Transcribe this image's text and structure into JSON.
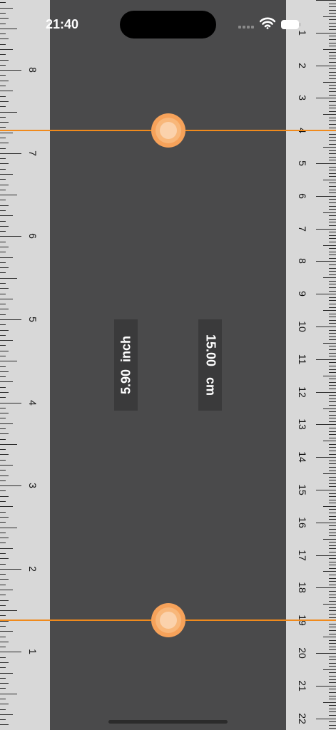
{
  "status_bar": {
    "time": "21:40",
    "icons": [
      "cellular-signal-icon",
      "wifi-icon",
      "battery-icon"
    ]
  },
  "inch_ruler": {
    "labels": [
      "1",
      "2",
      "3",
      "4",
      "5",
      "6",
      "7",
      "8"
    ],
    "unit": "inch"
  },
  "cm_ruler": {
    "labels": [
      "1",
      "2",
      "3",
      "4",
      "5",
      "6",
      "7",
      "8",
      "9",
      "10",
      "11",
      "12",
      "13",
      "14",
      "15",
      "16",
      "17",
      "18",
      "19",
      "20",
      "21",
      "22"
    ],
    "unit": "cm"
  },
  "measurement": {
    "inch_value": "5.90",
    "inch_unit": "inch",
    "cm_value": "15.00",
    "cm_unit": "cm",
    "upper_mark_cm": 4,
    "lower_mark_cm": 19
  },
  "colors": {
    "accent": "#f08a1c",
    "background": "#4a4a4b",
    "ruler": "#d8d8d8",
    "readout_bg": "#3a3a3b"
  }
}
